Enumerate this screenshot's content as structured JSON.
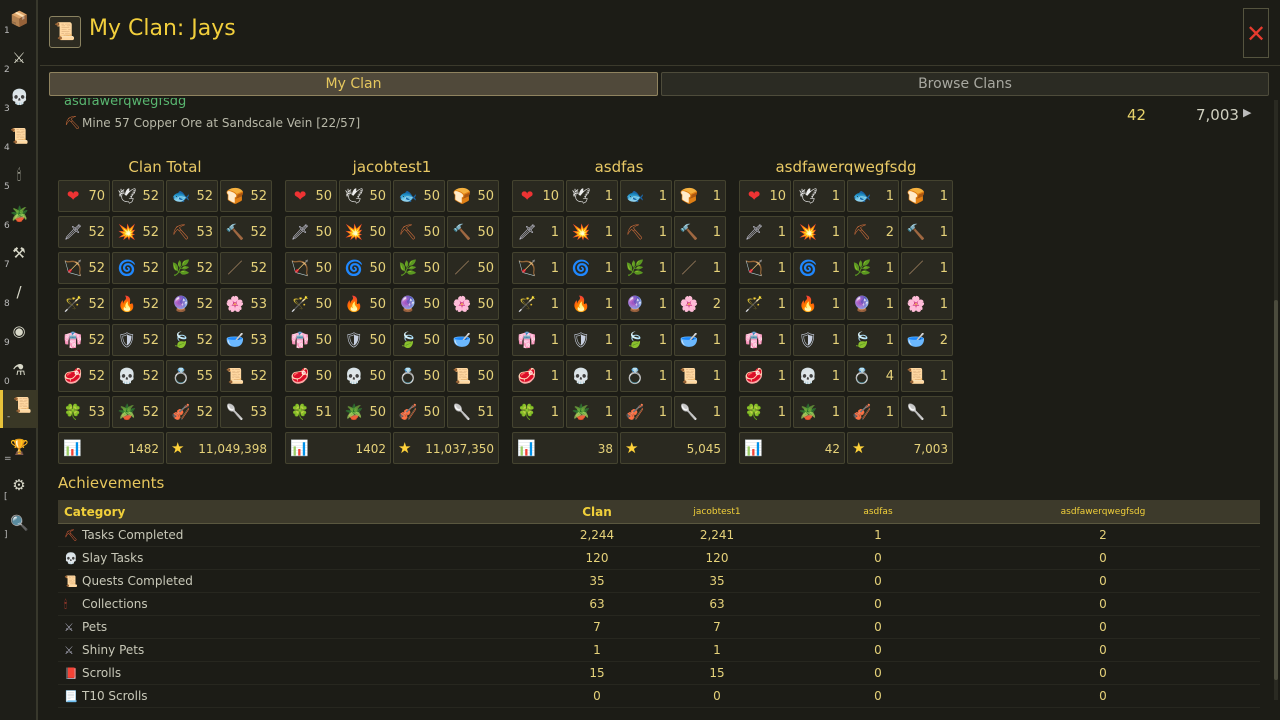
{
  "sidebar": [
    {
      "icon": "chest-icon",
      "glyph": "📦",
      "key": "1"
    },
    {
      "icon": "crossed-swords-icon",
      "glyph": "⚔",
      "key": "2"
    },
    {
      "icon": "skull-icon",
      "glyph": "💀",
      "key": "3"
    },
    {
      "icon": "quest-scroll-icon",
      "glyph": "📜",
      "key": "4"
    },
    {
      "icon": "candle-icon",
      "glyph": "🕯",
      "key": "5"
    },
    {
      "icon": "plant-pot-icon",
      "glyph": "🪴",
      "key": "6"
    },
    {
      "icon": "anvil-icon",
      "glyph": "⚒",
      "key": "7"
    },
    {
      "icon": "staff-icon",
      "glyph": "/",
      "key": "8"
    },
    {
      "icon": "orb-icon",
      "glyph": "◉",
      "key": "9"
    },
    {
      "icon": "mortar-icon",
      "glyph": "⚗",
      "key": "0"
    },
    {
      "icon": "clan-scroll-icon",
      "glyph": "📜",
      "key": "-"
    },
    {
      "icon": "trophy-icon",
      "glyph": "🏆",
      "key": "="
    },
    {
      "icon": "gear-icon",
      "glyph": "⚙",
      "key": "["
    },
    {
      "icon": "magnifier-icon",
      "glyph": "🔍",
      "key": "]"
    }
  ],
  "header": {
    "title": "My Clan: Jays",
    "close": "✕"
  },
  "tabs": {
    "my_clan": "My Clan",
    "browse": "Browse Clans"
  },
  "member": {
    "name": "asdfawerqwegfsdg",
    "task": "Mine 57 Copper Ore at Sandscale Vein [22/57]",
    "level": "42",
    "score": "7,003"
  },
  "skill_icons": [
    [
      "❤",
      "🕊",
      "🐟",
      "🍞"
    ],
    [
      "🗡",
      "💥",
      "⛏",
      "🔨"
    ],
    [
      "🏹",
      "🌀",
      "🌿",
      "／"
    ],
    [
      "🪄",
      "🔥",
      "🔮",
      "🌸"
    ],
    [
      "👘",
      "🛡",
      "🍃",
      "🥣"
    ],
    [
      "🥩",
      "💀",
      "💍",
      "📜"
    ],
    [
      "🍀",
      "🪴",
      "🎻",
      "🥄"
    ]
  ],
  "icon_colors": [
    [
      "#e33",
      "#eee",
      "#4a8ad8",
      "#e08a3a"
    ],
    [
      "#ccd",
      "#ffb020",
      "#c86a3a",
      "#999"
    ],
    [
      "#b05a3a",
      "#5ac05a",
      "#8ab040",
      "#aa8866"
    ],
    [
      "#6ac6ff",
      "#ff7a3a",
      "#a070e0",
      "#ff70c0"
    ],
    [
      "#d8c8a8",
      "#c8d0e0",
      "#60b040",
      "#ccc"
    ],
    [
      "#c83a3a",
      "#eee",
      "#e8a030",
      "#e8c890"
    ],
    [
      "#ffc020",
      "#c86a3a",
      "#a06a40",
      "#ccc"
    ]
  ],
  "grids": [
    {
      "title": "Clan Total",
      "values": [
        [
          "70",
          "52",
          "52",
          "52"
        ],
        [
          "52",
          "52",
          "53",
          "52"
        ],
        [
          "52",
          "52",
          "52",
          "52"
        ],
        [
          "52",
          "52",
          "52",
          "53"
        ],
        [
          "52",
          "52",
          "52",
          "53"
        ],
        [
          "52",
          "52",
          "55",
          "52"
        ],
        [
          "53",
          "52",
          "52",
          "53"
        ]
      ],
      "total_level": "1482",
      "total_score": "11,049,398"
    },
    {
      "title": "jacobtest1",
      "values": [
        [
          "50",
          "50",
          "50",
          "50"
        ],
        [
          "50",
          "50",
          "50",
          "50"
        ],
        [
          "50",
          "50",
          "50",
          "50"
        ],
        [
          "50",
          "50",
          "50",
          "50"
        ],
        [
          "50",
          "50",
          "50",
          "50"
        ],
        [
          "50",
          "50",
          "50",
          "50"
        ],
        [
          "51",
          "50",
          "50",
          "51"
        ]
      ],
      "total_level": "1402",
      "total_score": "11,037,350"
    },
    {
      "title": "asdfas",
      "values": [
        [
          "10",
          "1",
          "1",
          "1"
        ],
        [
          "1",
          "1",
          "1",
          "1"
        ],
        [
          "1",
          "1",
          "1",
          "1"
        ],
        [
          "1",
          "1",
          "1",
          "2"
        ],
        [
          "1",
          "1",
          "1",
          "1"
        ],
        [
          "1",
          "1",
          "1",
          "1"
        ],
        [
          "1",
          "1",
          "1",
          "1"
        ]
      ],
      "total_level": "38",
      "total_score": "5,045"
    },
    {
      "title": "asdfawerqwegfsdg",
      "values": [
        [
          "10",
          "1",
          "1",
          "1"
        ],
        [
          "1",
          "1",
          "2",
          "1"
        ],
        [
          "1",
          "1",
          "1",
          "1"
        ],
        [
          "1",
          "1",
          "1",
          "1"
        ],
        [
          "1",
          "1",
          "1",
          "2"
        ],
        [
          "1",
          "1",
          "4",
          "1"
        ],
        [
          "1",
          "1",
          "1",
          "1"
        ]
      ],
      "total_level": "42",
      "total_score": "7,003"
    }
  ],
  "achievements": {
    "title": "Achievements",
    "headers": {
      "category": "Category",
      "clan": "Clan",
      "m1": "jacobtest1",
      "m2": "asdfas",
      "m3": "asdfawerqwegfsdg"
    },
    "rows": [
      {
        "icon": "pickaxe-icon",
        "glyph": "⛏",
        "color": "#e0603a",
        "label": "Tasks Completed",
        "clan": "2,244",
        "m1": "2,241",
        "m2": "1",
        "m3": "2"
      },
      {
        "icon": "skull-icon",
        "glyph": "💀",
        "color": "#eee",
        "label": "Slay Tasks",
        "clan": "120",
        "m1": "120",
        "m2": "0",
        "m3": "0"
      },
      {
        "icon": "quest-scroll-icon",
        "glyph": "📜",
        "color": "#e8c890",
        "label": "Quests Completed",
        "clan": "35",
        "m1": "35",
        "m2": "0",
        "m3": "0"
      },
      {
        "icon": "candle-icon",
        "glyph": "🕯",
        "color": "#e84a3a",
        "label": "Collections",
        "clan": "63",
        "m1": "63",
        "m2": "0",
        "m3": "0"
      },
      {
        "icon": "crossed-swords-icon",
        "glyph": "⚔",
        "color": "#aab",
        "label": "Pets",
        "clan": "7",
        "m1": "7",
        "m2": "0",
        "m3": "0"
      },
      {
        "icon": "crossed-swords-icon",
        "glyph": "⚔",
        "color": "#aab",
        "label": "Shiny Pets",
        "clan": "1",
        "m1": "1",
        "m2": "0",
        "m3": "0"
      },
      {
        "icon": "red-scroll-icon",
        "glyph": "📕",
        "color": "#e33",
        "label": "Scrolls",
        "clan": "15",
        "m1": "15",
        "m2": "0",
        "m3": "0"
      },
      {
        "icon": "white-scroll-icon",
        "glyph": "📃",
        "color": "#eee",
        "label": "T10 Scrolls",
        "clan": "0",
        "m1": "0",
        "m2": "0",
        "m3": "0"
      }
    ]
  }
}
